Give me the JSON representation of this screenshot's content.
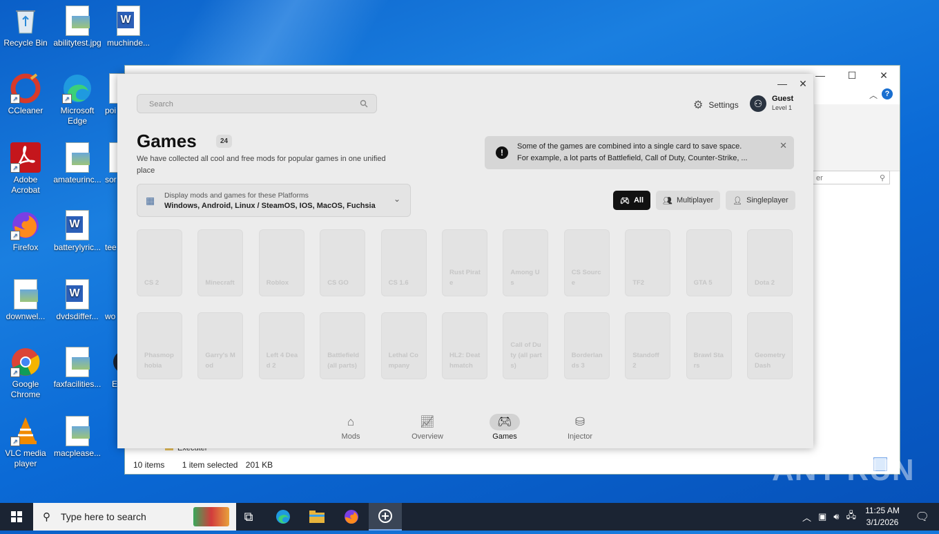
{
  "desktop": {
    "icons": [
      {
        "label": "Recycle Bin"
      },
      {
        "label": "abilitytest.jpg"
      },
      {
        "label": "muchinde..."
      },
      {
        "label": "CCleaner"
      },
      {
        "label": "Microsoft Edge"
      },
      {
        "label": "poi"
      },
      {
        "label": "Adobe Acrobat"
      },
      {
        "label": "amateurinc..."
      },
      {
        "label": "sor"
      },
      {
        "label": "Firefox"
      },
      {
        "label": "batterylyric..."
      },
      {
        "label": "tee"
      },
      {
        "label": "downwel..."
      },
      {
        "label": "dvdsdiffer..."
      },
      {
        "label": "wo"
      },
      {
        "label": "Google Chrome"
      },
      {
        "label": "faxfacilities..."
      },
      {
        "label": "E"
      },
      {
        "label": "VLC media player"
      },
      {
        "label": "macpleasе..."
      }
    ]
  },
  "explorer": {
    "status_items": "10 items",
    "status_selected": "1 item selected",
    "status_size": "201 KB",
    "search_placeholder": "er",
    "folder_label": "Executer"
  },
  "app": {
    "search_placeholder": "Search",
    "settings_label": "Settings",
    "user_name": "Guest",
    "user_level": "Level 1",
    "title": "Games",
    "count": "24",
    "description": "We have collected all cool and free mods for popular games in one unified place",
    "notice_line1": "Some of the games are combined into a single card to save space.",
    "notice_line2": "For example, a lot parts of Battlefield, Call of Duty, Counter-Strike, ...",
    "platform_label": "Display mods and games for these Platforms",
    "platform_value": "Windows, Android, Linux / SteamOS, IOS, MacOS, Fuchsia",
    "filters": [
      {
        "label": "All",
        "icon": "gamepad-icon",
        "active": true
      },
      {
        "label": "Multiplayer",
        "icon": "users-icon",
        "active": false
      },
      {
        "label": "Singleplayer",
        "icon": "user-icon",
        "active": false
      }
    ],
    "games": [
      "CS 2",
      "Minecraft",
      "Roblox",
      "CS GO",
      "CS 1.6",
      "Rust Pirate",
      "Among Us",
      "CS Source",
      "TF2",
      "GTA 5",
      "Dota 2",
      "Phasmophobia",
      "Garry's Mod",
      "Left 4 Dead 2",
      "Battlefield (all parts)",
      "Lethal Company",
      "HL2: Deathmatch",
      "Call of Duty (all parts)",
      "Borderlands 3",
      "Standoff 2",
      "Brawl Stars",
      "Geometry Dash"
    ],
    "nav": [
      {
        "label": "Mods",
        "icon": "home-icon"
      },
      {
        "label": "Overview",
        "icon": "chart-icon"
      },
      {
        "label": "Games",
        "icon": "gamepad-icon"
      },
      {
        "label": "Injector",
        "icon": "database-icon"
      }
    ]
  },
  "taskbar": {
    "search_text": "Type here to search",
    "time": "11:25 AM",
    "date": "3/1/2026"
  },
  "watermark": "ANY RUN",
  "colors": {
    "accent": "#111111",
    "desktop": "#0b6ad6",
    "taskbar": "#1b2433"
  }
}
